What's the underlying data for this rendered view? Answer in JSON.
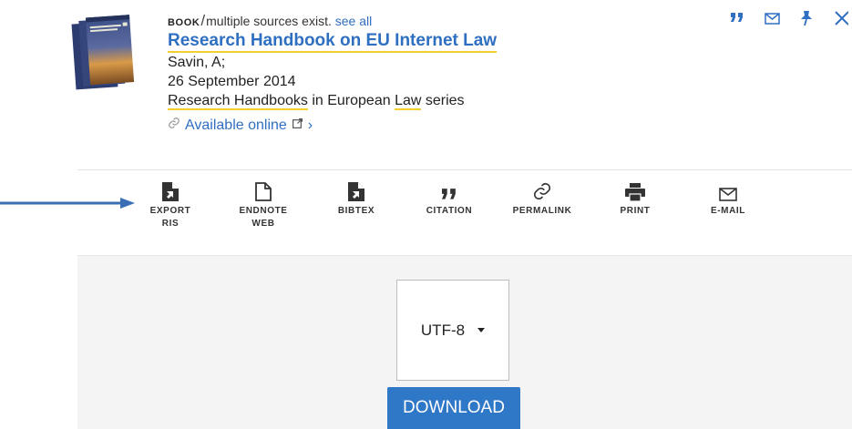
{
  "record": {
    "type_label": "BOOK",
    "separator": "/",
    "sources_text": "multiple sources exist.",
    "see_all": "see all",
    "title": "Research Handbook on EU Internet Law",
    "author": "Savin, A;",
    "date": "26 September 2014",
    "series_part1": "Research Handbooks",
    "series_part2": " in European ",
    "series_part3": "Law",
    "series_part4": " series",
    "availability": "Available online",
    "availability_chevron": "›"
  },
  "top_actions": [
    {
      "icon": "quote-icon"
    },
    {
      "icon": "envelope-icon"
    },
    {
      "icon": "pin-icon"
    },
    {
      "icon": "close-icon"
    }
  ],
  "toolbar": [
    {
      "label": "EXPORT\nRIS",
      "icon": "export-file-icon"
    },
    {
      "label": "ENDNOTE\nWEB",
      "icon": "document-icon"
    },
    {
      "label": "BIBTEX",
      "icon": "export-file-icon"
    },
    {
      "label": "CITATION",
      "icon": "quote-icon"
    },
    {
      "label": "PERMALINK",
      "icon": "link-icon"
    },
    {
      "label": "PRINT",
      "icon": "printer-icon"
    },
    {
      "label": "E-MAIL",
      "icon": "envelope-icon"
    }
  ],
  "export_panel": {
    "encoding_value": "UTF-8",
    "download_label": "DOWNLOAD"
  },
  "colors": {
    "accent": "#2f6fc2",
    "highlight": "#f4cf2e",
    "download_bg": "#2f78c8",
    "panel_bg": "#f4f4f4"
  }
}
